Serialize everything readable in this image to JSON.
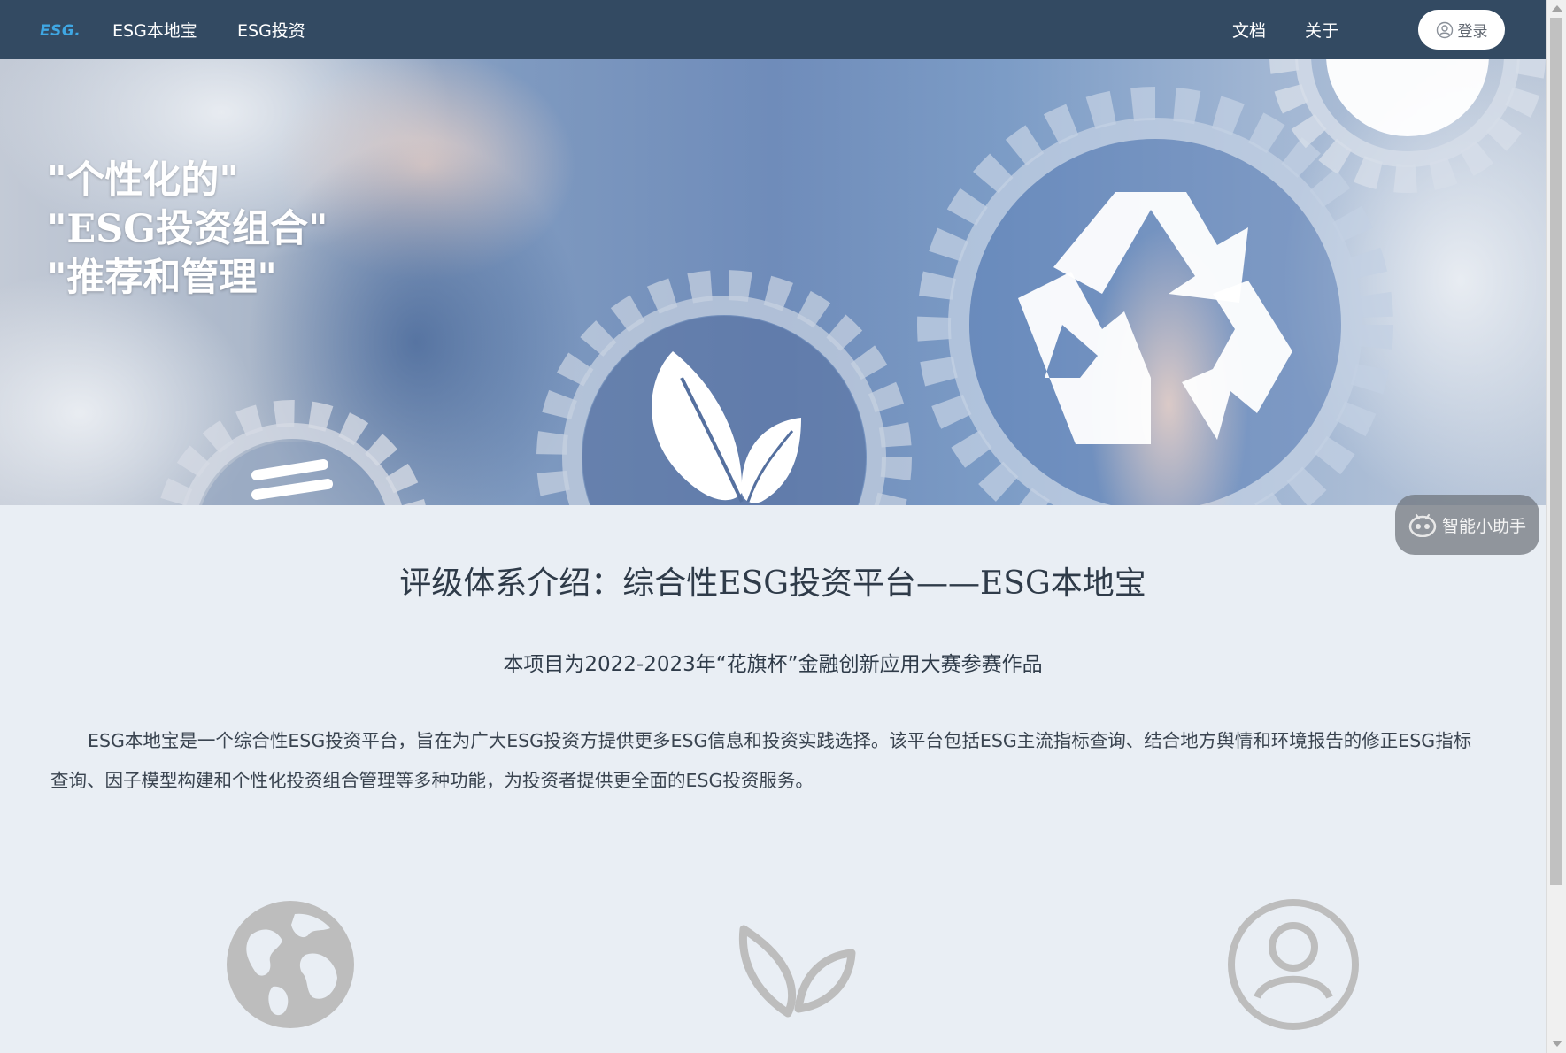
{
  "navbar": {
    "logo": "ESG.",
    "links": [
      "ESG本地宝",
      "ESG投资"
    ],
    "right_links": [
      "文档",
      "关于"
    ],
    "login_label": "登录"
  },
  "hero": {
    "slogan": [
      "\"个性化的\"",
      "\"ESG投资组合\"",
      "\"推荐和管理\""
    ]
  },
  "assistant": {
    "label": "智能小助手"
  },
  "intro": {
    "title": "评级体系介绍：综合性ESG投资平台——ESG本地宝",
    "subtitle": "本项目为2022-2023年“花旗杯”金融创新应用大赛参赛作品",
    "body": "ESG本地宝是一个综合性ESG投资平台，旨在为广大ESG投资方提供更多ESG信息和投资实践选择。该平台包括ESG主流指标查询、结合地方舆情和环境报告的修正ESG指标查询、因子模型构建和个性化投资组合管理等多种功能，为投资者提供更全面的ESG投资服务。"
  },
  "features": [
    {
      "icon": "globe-icon"
    },
    {
      "icon": "leaf-icon"
    },
    {
      "icon": "user-icon"
    }
  ],
  "colors": {
    "navbar_bg": "#334a62",
    "logo": "#3fa7e3",
    "page_bg": "#e9eef4",
    "icon_gray": "#bdbdbd"
  }
}
